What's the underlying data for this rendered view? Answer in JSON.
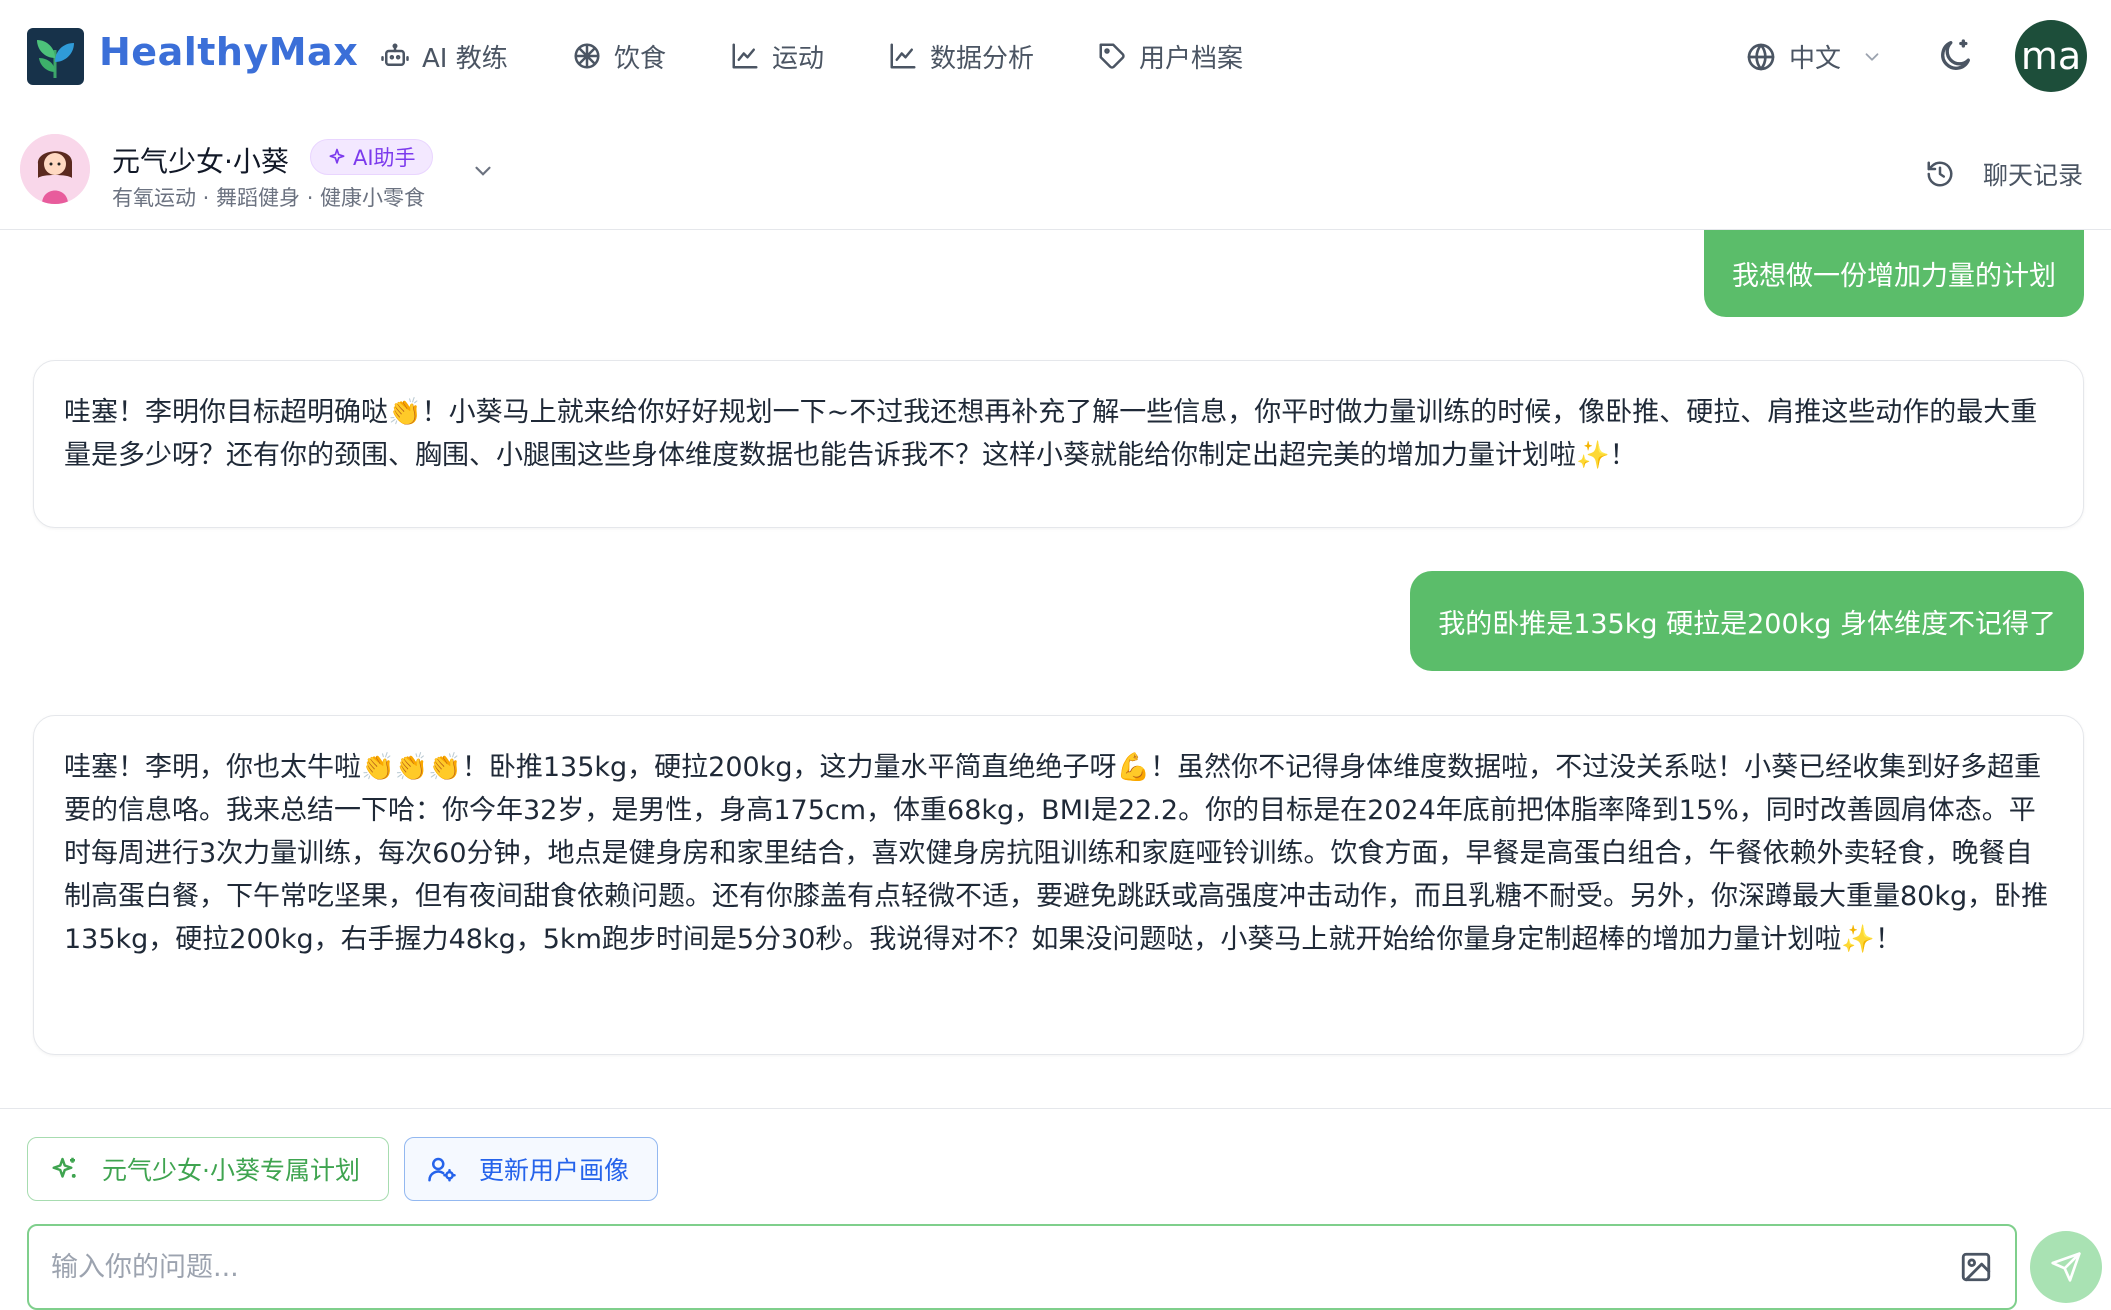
{
  "nav": {
    "brand": "HealthyMax",
    "items": [
      {
        "label": "AI 教练",
        "icon": "robot-icon"
      },
      {
        "label": "饮食",
        "icon": "food-icon"
      },
      {
        "label": "运动",
        "icon": "chart-line-icon"
      },
      {
        "label": "数据分析",
        "icon": "chart-line-icon"
      },
      {
        "label": "用户档案",
        "icon": "tag-icon"
      }
    ],
    "language": "中文",
    "user_initials": "ma"
  },
  "assistant": {
    "name": "元气少女·小葵",
    "badge": "AI助手",
    "tags": "有氧运动 · 舞蹈健身 · 健康小零食",
    "history_label": "聊天记录"
  },
  "messages": [
    {
      "role": "user",
      "text": "我想做一份增加力量的计划"
    },
    {
      "role": "assistant",
      "text": "哇塞！李明你目标超明确哒👏！小葵马上就来给你好好规划一下~不过我还想再补充了解一些信息，你平时做力量训练的时候，像卧推、硬拉、肩推这些动作的最大重量是多少呀？还有你的颈围、胸围、小腿围这些身体维度数据也能告诉我不？这样小葵就能给你制定出超完美的增加力量计划啦✨！"
    },
    {
      "role": "user",
      "text": "我的卧推是135kg 硬拉是200kg 身体维度不记得了"
    },
    {
      "role": "assistant",
      "text": "哇塞！李明，你也太牛啦👏👏👏！卧推135kg，硬拉200kg，这力量水平简直绝绝子呀💪！虽然你不记得身体维度数据啦，不过没关系哒！小葵已经收集到好多超重要的信息咯。我来总结一下哈：你今年32岁，是男性，身高175cm，体重68kg，BMI是22.2。你的目标是在2024年底前把体脂率降到15%，同时改善圆肩体态。平时每周进行3次力量训练，每次60分钟，地点是健身房和家里结合，喜欢健身房抗阻训练和家庭哑铃训练。饮食方面，早餐是高蛋白组合，午餐依赖外卖轻食，晚餐自制高蛋白餐，下午常吃坚果，但有夜间甜食依赖问题。还有你膝盖有点轻微不适，要避免跳跃或高强度冲击动作，而且乳糖不耐受。另外，你深蹲最大重量80kg，卧推135kg，硬拉200kg，右手握力48kg，5km跑步时间是5分30秒。我说得对不？如果没问题哒，小葵马上就开始给你量身定制超棒的增加力量计划啦✨！"
    }
  ],
  "actions": {
    "plan_label": "元气少女·小葵专属计划",
    "update_label": "更新用户画像"
  },
  "input": {
    "placeholder": "输入你的问题..."
  }
}
